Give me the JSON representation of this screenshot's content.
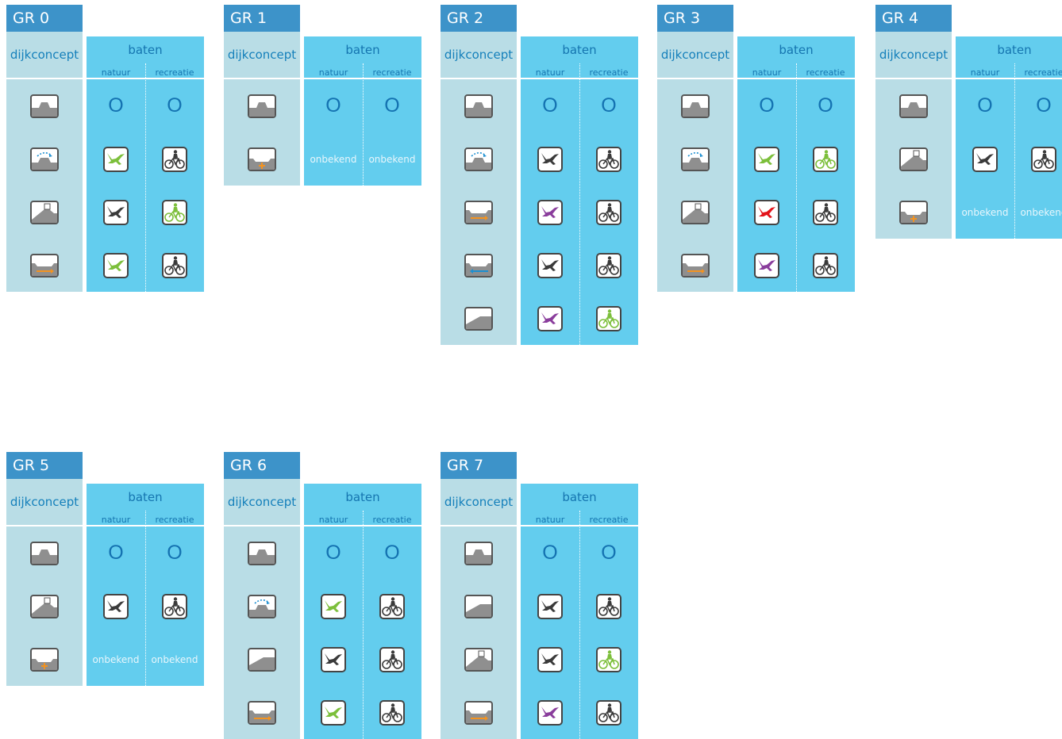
{
  "labels": {
    "dijkconcept": "dijkconcept",
    "baten": "baten",
    "natuur": "natuur",
    "recreatie": "recreatie",
    "zero": "O",
    "onbekend": "onbekend"
  },
  "colors": {
    "green": "#7cbf3b",
    "purple": "#8a3d9c",
    "red": "#e3141b",
    "dark": "#3a3a3a",
    "tab": "#3d93c9",
    "left": "#b9dde6",
    "right": "#63cdee"
  },
  "groups": [
    {
      "title": "GR 0",
      "rows": [
        {
          "dike": "basic",
          "natuur": "zero",
          "recreatie": "zero"
        },
        {
          "dike": "overflow",
          "natuur": "green",
          "recreatie": "dark"
        },
        {
          "dike": "building",
          "natuur": "dark",
          "recreatie": "green"
        },
        {
          "dike": "wide-right",
          "natuur": "green",
          "recreatie": "dark"
        }
      ]
    },
    {
      "title": "GR 1",
      "rows": [
        {
          "dike": "basic",
          "natuur": "zero",
          "recreatie": "zero"
        },
        {
          "dike": "plus",
          "natuur": "onbekend",
          "recreatie": "onbekend"
        }
      ]
    },
    {
      "title": "GR 2",
      "rows": [
        {
          "dike": "basic",
          "natuur": "zero",
          "recreatie": "zero"
        },
        {
          "dike": "overflow",
          "natuur": "dark",
          "recreatie": "dark"
        },
        {
          "dike": "wide-right",
          "natuur": "purple",
          "recreatie": "dark"
        },
        {
          "dike": "wide-left",
          "natuur": "dark",
          "recreatie": "dark"
        },
        {
          "dike": "slope",
          "natuur": "purple",
          "recreatie": "green"
        }
      ]
    },
    {
      "title": "GR 3",
      "rows": [
        {
          "dike": "basic",
          "natuur": "zero",
          "recreatie": "zero"
        },
        {
          "dike": "overflow",
          "natuur": "green",
          "recreatie": "green"
        },
        {
          "dike": "building",
          "natuur": "red",
          "recreatie": "dark"
        },
        {
          "dike": "wide-right",
          "natuur": "purple",
          "recreatie": "dark"
        }
      ]
    },
    {
      "title": "GR 4",
      "rows": [
        {
          "dike": "basic",
          "natuur": "zero",
          "recreatie": "zero"
        },
        {
          "dike": "building",
          "natuur": "dark",
          "recreatie": "dark"
        },
        {
          "dike": "plus",
          "natuur": "onbekend",
          "recreatie": "onbekend"
        }
      ]
    },
    {
      "title": "GR 5",
      "rows": [
        {
          "dike": "basic",
          "natuur": "zero",
          "recreatie": "zero"
        },
        {
          "dike": "building",
          "natuur": "dark",
          "recreatie": "dark"
        },
        {
          "dike": "plus",
          "natuur": "onbekend",
          "recreatie": "onbekend"
        }
      ]
    },
    {
      "title": "GR 6",
      "rows": [
        {
          "dike": "basic",
          "natuur": "zero",
          "recreatie": "zero"
        },
        {
          "dike": "overflow",
          "natuur": "green",
          "recreatie": "dark"
        },
        {
          "dike": "slope",
          "natuur": "dark",
          "recreatie": "dark"
        },
        {
          "dike": "wide-right",
          "natuur": "green",
          "recreatie": "dark"
        }
      ]
    },
    {
      "title": "GR 7",
      "rows": [
        {
          "dike": "basic",
          "natuur": "zero",
          "recreatie": "zero"
        },
        {
          "dike": "slope",
          "natuur": "dark",
          "recreatie": "dark"
        },
        {
          "dike": "building",
          "natuur": "dark",
          "recreatie": "green"
        },
        {
          "dike": "wide-right",
          "natuur": "purple",
          "recreatie": "dark"
        }
      ]
    }
  ]
}
